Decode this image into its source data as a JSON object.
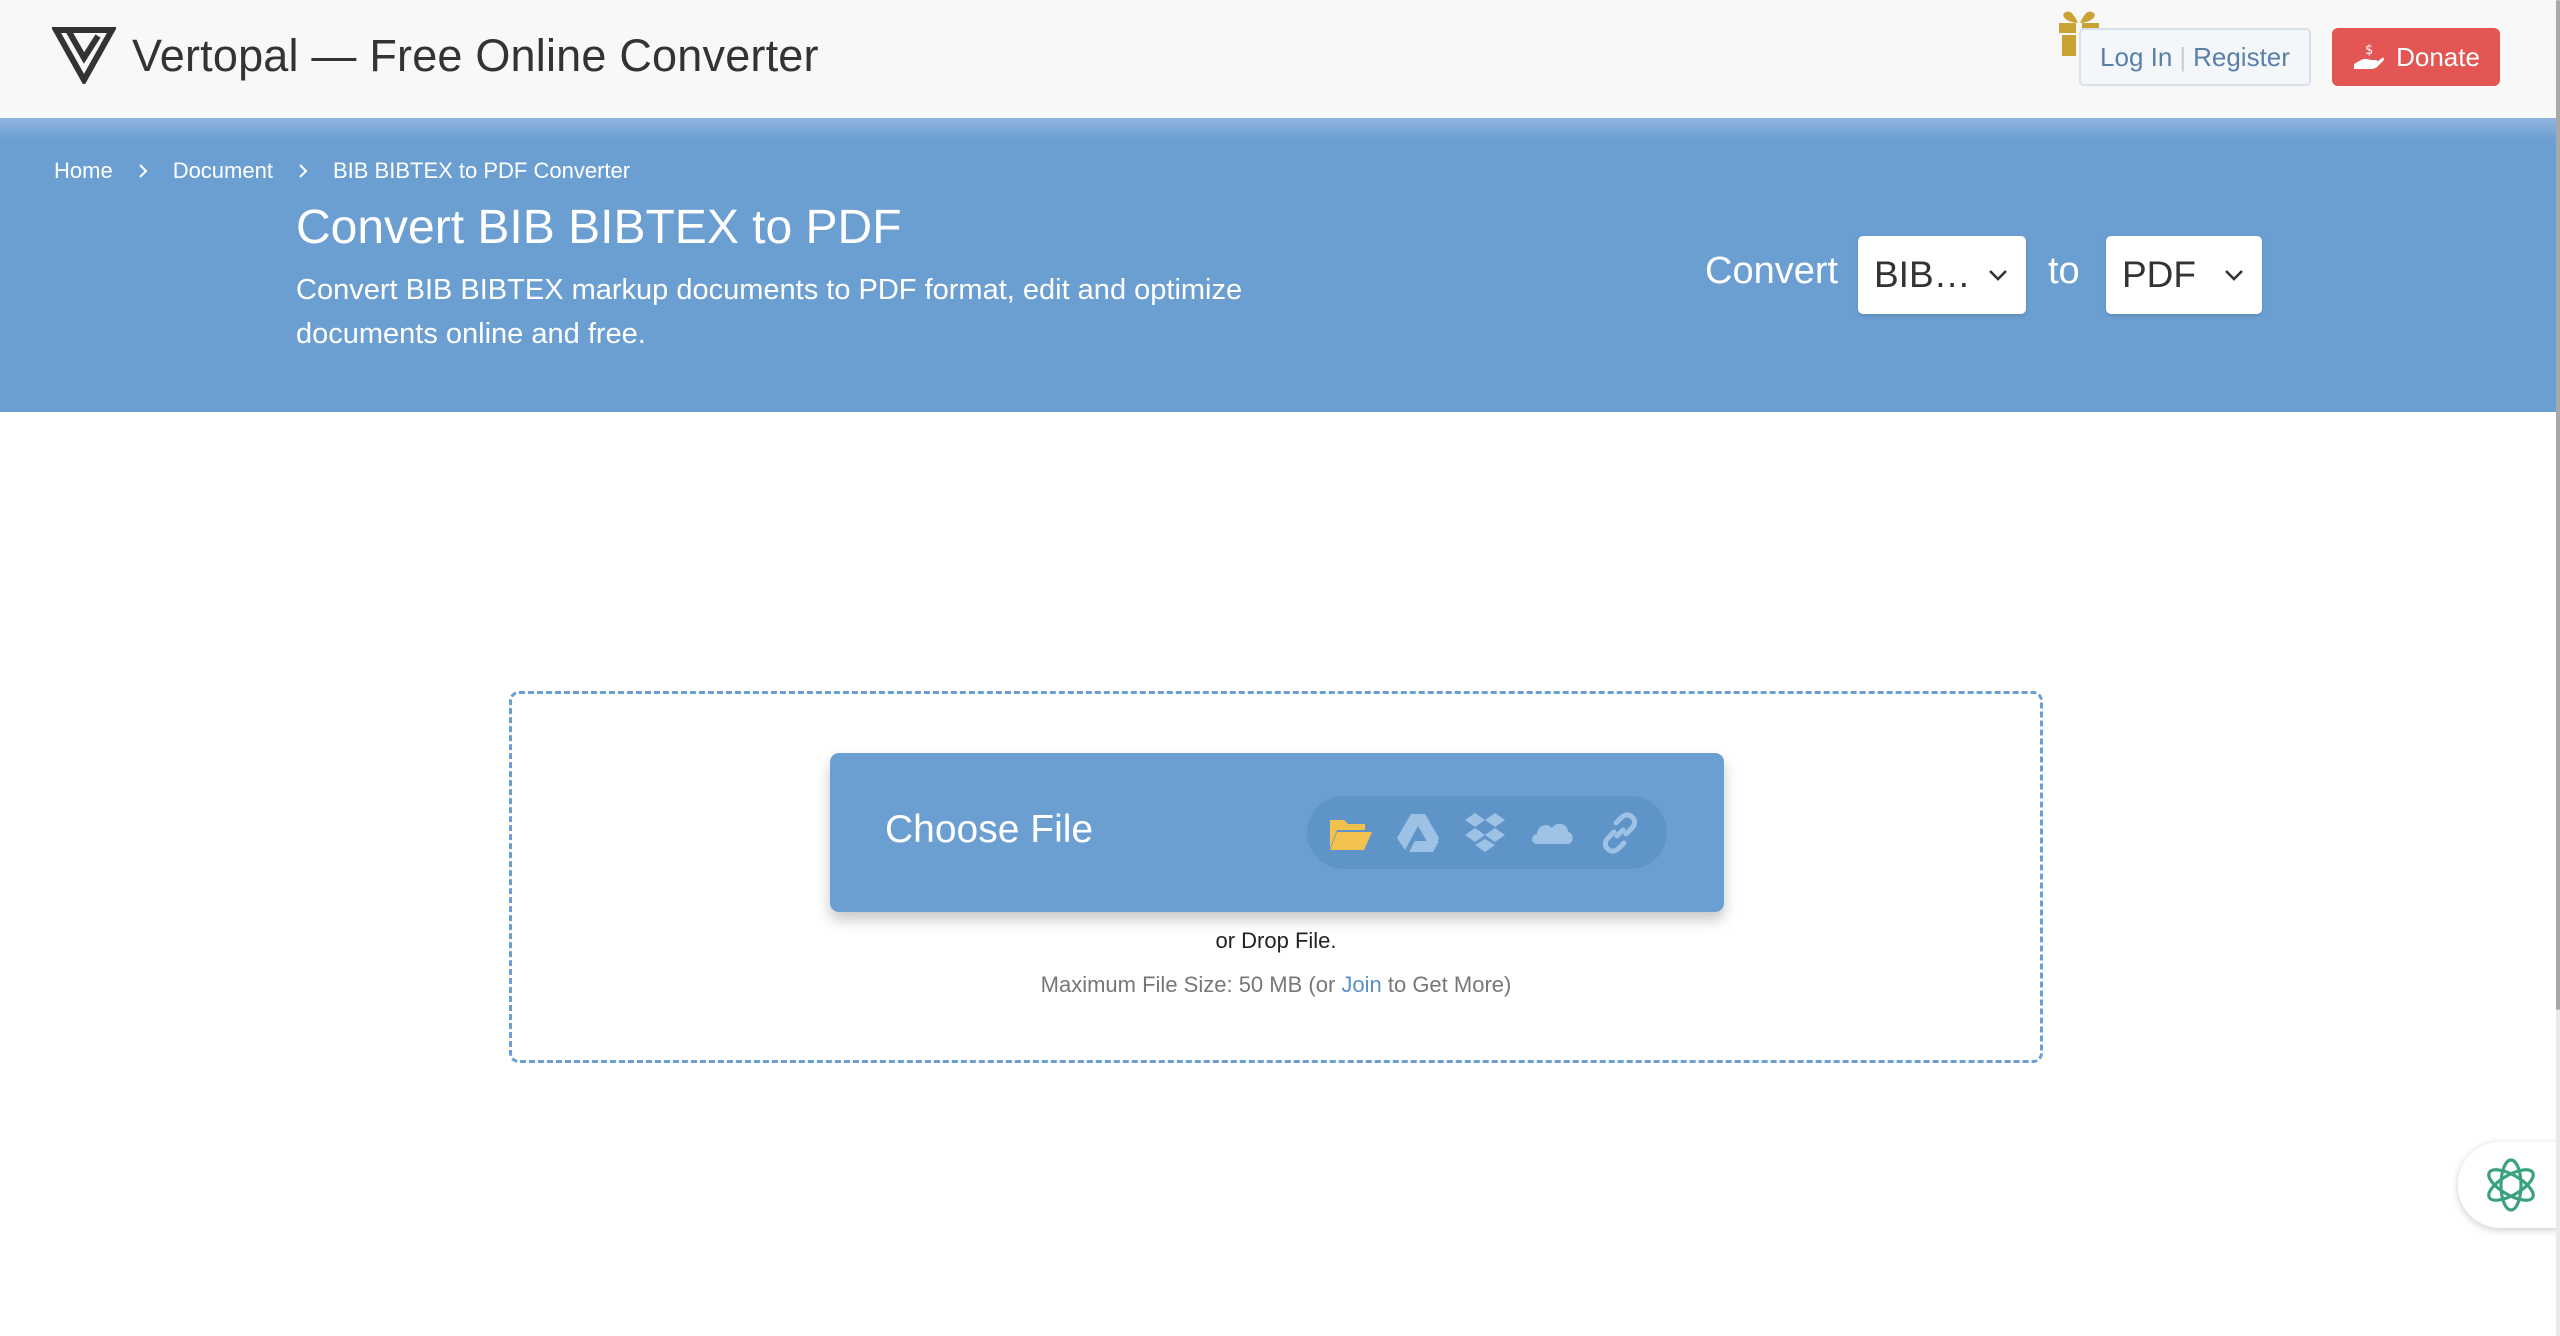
{
  "header": {
    "brand": "Vertopal — Free Online Converter",
    "login_label": "Log In",
    "separator": "|",
    "register_label": "Register",
    "donate_label": "Donate"
  },
  "breadcrumb": {
    "items": [
      "Home",
      "Document",
      "BIB BIBTEX to PDF Converter"
    ]
  },
  "hero": {
    "title": "Convert BIB BIBTEX to PDF",
    "description": "Convert BIB BIBTEX markup documents to PDF format, edit and optimize documents online and free."
  },
  "converter": {
    "convert_label": "Convert",
    "from_value": "BIB…",
    "to_label": "to",
    "to_value": "PDF"
  },
  "upload": {
    "choose_label": "Choose File",
    "drop_text": "or Drop File.",
    "max_prefix": "Maximum File Size: 50 MB (or ",
    "join_label": "Join",
    "max_suffix": " to Get More)",
    "sources": [
      "folder-icon",
      "google-drive-icon",
      "dropbox-icon",
      "onedrive-icon",
      "link-icon"
    ]
  },
  "colors": {
    "accent": "#6c9fd1",
    "donate": "#e45654",
    "folder": "#f2c14e"
  }
}
